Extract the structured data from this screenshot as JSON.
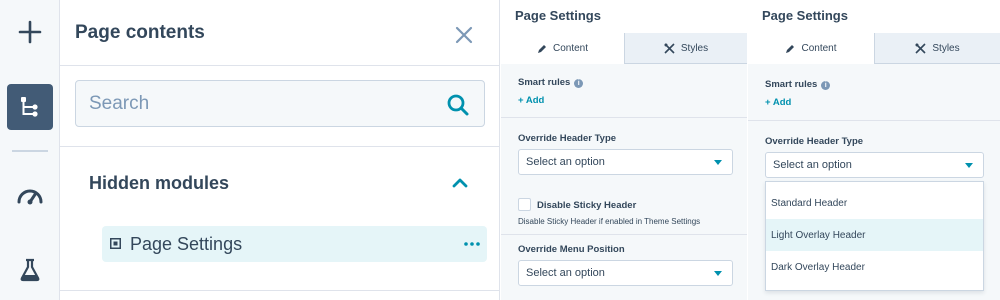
{
  "page_contents": {
    "title": "Page contents",
    "search_placeholder": "Search",
    "group_title": "Hidden modules",
    "module_label": "Page Settings"
  },
  "settings_panel": {
    "title": "Page Settings",
    "tab_content": "Content",
    "tab_styles": "Styles",
    "smart_rules_label": "Smart rules",
    "info_glyph": "i",
    "add_label": "+ Add",
    "override_header_label": "Override Header Type",
    "override_header_value": "Select an option",
    "disable_sticky_label": "Disable Sticky Header",
    "disable_sticky_help": "Disable Sticky Header if enabled in Theme Settings",
    "override_menu_label": "Override Menu Position",
    "override_menu_value": "Select an option"
  },
  "settings_panel_open": {
    "title": "Page Settings",
    "tab_content": "Content",
    "tab_styles": "Styles",
    "smart_rules_label": "Smart rules",
    "info_glyph": "i",
    "add_label": "+ Add",
    "override_header_label": "Override Header Type",
    "override_header_value": "Select an option",
    "options": [
      "Standard Header",
      "Light Overlay Header",
      "Dark Overlay Header"
    ],
    "hovered_option": "Light Overlay Header"
  },
  "icons": {
    "rail": [
      "plus-icon",
      "tree-icon",
      "gauge-icon",
      "flask-icon"
    ]
  },
  "colors": {
    "accent": "#0091ae",
    "text": "#33475b",
    "rail_active": "#425b76",
    "highlight": "#e5f5f8"
  }
}
